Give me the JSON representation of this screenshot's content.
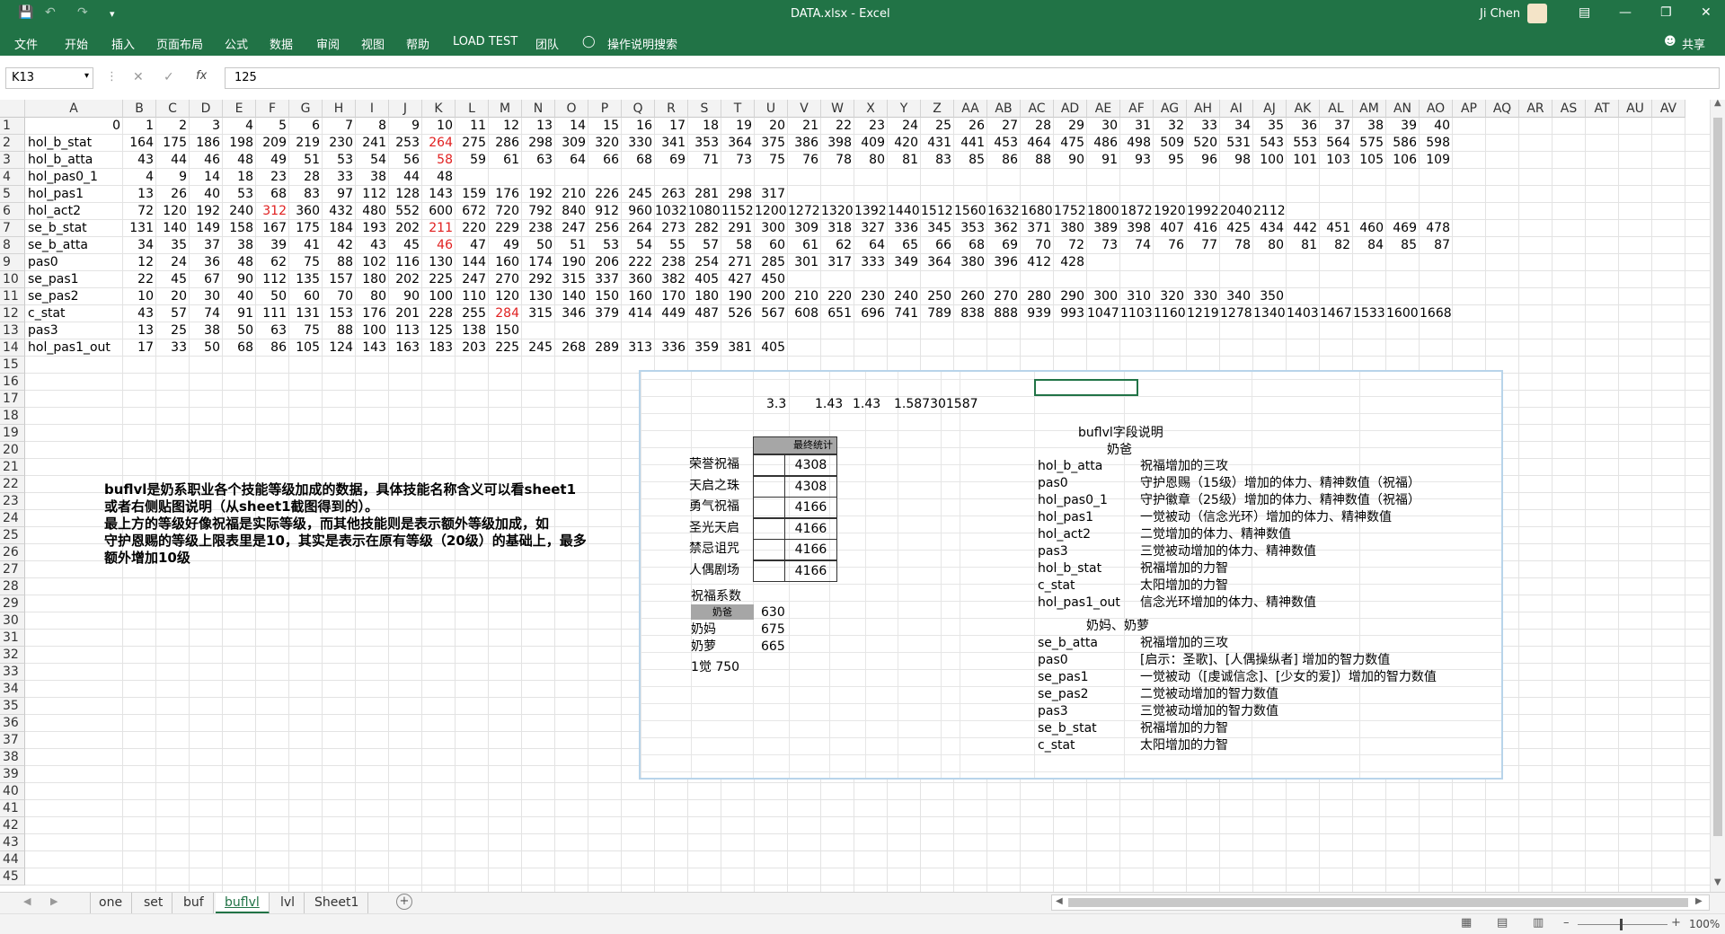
{
  "titlebar": {
    "title": "DATA.xlsx  -  Excel",
    "user": "Ji Chen",
    "share": "共享"
  },
  "menu": [
    "文件",
    "开始",
    "插入",
    "页面布局",
    "公式",
    "数据",
    "审阅",
    "视图",
    "帮助",
    "LOAD TEST",
    "团队"
  ],
  "tell_me": "操作说明搜索",
  "formula_bar": {
    "name_box": "K13",
    "fx": "fx",
    "value": "125"
  },
  "columns": [
    "A",
    "B",
    "C",
    "D",
    "E",
    "F",
    "G",
    "H",
    "I",
    "J",
    "K",
    "L",
    "M",
    "N",
    "O",
    "P",
    "Q",
    "R",
    "S",
    "T",
    "U",
    "V",
    "W",
    "X",
    "Y",
    "Z",
    "AA",
    "AB",
    "AC",
    "AD",
    "AE",
    "AF",
    "AG",
    "AH",
    "AI",
    "AJ",
    "AK",
    "AL",
    "AM",
    "AN",
    "AO",
    "AP",
    "AQ",
    "AR",
    "AS",
    "AT",
    "AU",
    "AV"
  ],
  "row_count": 45,
  "row1_values": [
    "0",
    "1",
    "2",
    "3",
    "4",
    "5",
    "6",
    "7",
    "8",
    "9",
    "10",
    "11",
    "12",
    "13",
    "14",
    "15",
    "16",
    "17",
    "18",
    "19",
    "20",
    "21",
    "22",
    "23",
    "24",
    "25",
    "26",
    "27",
    "28",
    "29",
    "30",
    "31",
    "32",
    "33",
    "34",
    "35",
    "36",
    "37",
    "38",
    "39",
    "40"
  ],
  "data_rows": [
    {
      "label": "hol_b_stat",
      "values": [
        "164",
        "175",
        "186",
        "198",
        "209",
        "219",
        "230",
        "241",
        "253",
        "264",
        "275",
        "286",
        "298",
        "309",
        "320",
        "330",
        "341",
        "353",
        "364",
        "375",
        "386",
        "398",
        "409",
        "420",
        "431",
        "441",
        "453",
        "464",
        "475",
        "486",
        "498",
        "509",
        "520",
        "531",
        "543",
        "553",
        "564",
        "575",
        "586",
        "598"
      ],
      "red": [
        9
      ]
    },
    {
      "label": "hol_b_atta",
      "values": [
        "43",
        "44",
        "46",
        "48",
        "49",
        "51",
        "53",
        "54",
        "56",
        "58",
        "59",
        "61",
        "63",
        "64",
        "66",
        "68",
        "69",
        "71",
        "73",
        "75",
        "76",
        "78",
        "80",
        "81",
        "83",
        "85",
        "86",
        "88",
        "90",
        "91",
        "93",
        "95",
        "96",
        "98",
        "100",
        "101",
        "103",
        "105",
        "106",
        "109"
      ],
      "red": [
        9
      ]
    },
    {
      "label": "hol_pas0_1",
      "values": [
        "4",
        "9",
        "14",
        "18",
        "23",
        "28",
        "33",
        "38",
        "44",
        "48"
      ],
      "red": []
    },
    {
      "label": "hol_pas1",
      "values": [
        "13",
        "26",
        "40",
        "53",
        "68",
        "83",
        "97",
        "112",
        "128",
        "143",
        "159",
        "176",
        "192",
        "210",
        "226",
        "245",
        "263",
        "281",
        "298",
        "317"
      ],
      "red": []
    },
    {
      "label": "hol_act2",
      "values": [
        "72",
        "120",
        "192",
        "240",
        "312",
        "360",
        "432",
        "480",
        "552",
        "600",
        "672",
        "720",
        "792",
        "840",
        "912",
        "960",
        "1032",
        "1080",
        "1152",
        "1200",
        "1272",
        "1320",
        "1392",
        "1440",
        "1512",
        "1560",
        "1632",
        "1680",
        "1752",
        "1800",
        "1872",
        "1920",
        "1992",
        "2040",
        "2112"
      ],
      "red": [
        4
      ]
    },
    {
      "label": "se_b_stat",
      "values": [
        "131",
        "140",
        "149",
        "158",
        "167",
        "175",
        "184",
        "193",
        "202",
        "211",
        "220",
        "229",
        "238",
        "247",
        "256",
        "264",
        "273",
        "282",
        "291",
        "300",
        "309",
        "318",
        "327",
        "336",
        "345",
        "353",
        "362",
        "371",
        "380",
        "389",
        "398",
        "407",
        "416",
        "425",
        "434",
        "442",
        "451",
        "460",
        "469",
        "478"
      ],
      "red": [
        9
      ]
    },
    {
      "label": "se_b_atta",
      "values": [
        "34",
        "35",
        "37",
        "38",
        "39",
        "41",
        "42",
        "43",
        "45",
        "46",
        "47",
        "49",
        "50",
        "51",
        "53",
        "54",
        "55",
        "57",
        "58",
        "60",
        "61",
        "62",
        "64",
        "65",
        "66",
        "68",
        "69",
        "70",
        "72",
        "73",
        "74",
        "76",
        "77",
        "78",
        "80",
        "81",
        "82",
        "84",
        "85",
        "87"
      ],
      "red": [
        9
      ]
    },
    {
      "label": "pas0",
      "values": [
        "12",
        "24",
        "36",
        "48",
        "62",
        "75",
        "88",
        "102",
        "116",
        "130",
        "144",
        "160",
        "174",
        "190",
        "206",
        "222",
        "238",
        "254",
        "271",
        "285",
        "301",
        "317",
        "333",
        "349",
        "364",
        "380",
        "396",
        "412",
        "428"
      ],
      "red": []
    },
    {
      "label": "se_pas1",
      "values": [
        "22",
        "45",
        "67",
        "90",
        "112",
        "135",
        "157",
        "180",
        "202",
        "225",
        "247",
        "270",
        "292",
        "315",
        "337",
        "360",
        "382",
        "405",
        "427",
        "450"
      ],
      "red": []
    },
    {
      "label": "se_pas2",
      "values": [
        "10",
        "20",
        "30",
        "40",
        "50",
        "60",
        "70",
        "80",
        "90",
        "100",
        "110",
        "120",
        "130",
        "140",
        "150",
        "160",
        "170",
        "180",
        "190",
        "200",
        "210",
        "220",
        "230",
        "240",
        "250",
        "260",
        "270",
        "280",
        "290",
        "300",
        "310",
        "320",
        "330",
        "340",
        "350"
      ],
      "red": []
    },
    {
      "label": "c_stat",
      "values": [
        "43",
        "57",
        "74",
        "91",
        "111",
        "131",
        "153",
        "176",
        "201",
        "228",
        "255",
        "284",
        "315",
        "346",
        "379",
        "414",
        "449",
        "487",
        "526",
        "567",
        "608",
        "651",
        "696",
        "741",
        "789",
        "838",
        "888",
        "939",
        "993",
        "1047",
        "1103",
        "1160",
        "1219",
        "1278",
        "1340",
        "1403",
        "1467",
        "1533",
        "1600",
        "1668"
      ],
      "red": [
        11
      ]
    },
    {
      "label": "pas3",
      "values": [
        "13",
        "25",
        "38",
        "50",
        "63",
        "75",
        "88",
        "100",
        "113",
        "125",
        "138",
        "150"
      ],
      "red": []
    },
    {
      "label": "hol_pas1_out",
      "values": [
        "17",
        "33",
        "50",
        "68",
        "86",
        "105",
        "124",
        "143",
        "163",
        "183",
        "203",
        "225",
        "245",
        "268",
        "289",
        "313",
        "336",
        "359",
        "381",
        "405"
      ],
      "red": []
    }
  ],
  "note_text": [
    "buflvl是奶系职业各个技能等级加成的数据，具体技能名称含义可以看sheet1",
    "或者右侧贴图说明（从sheet1截图得到的）。",
    "最上方的等级好像祝福是实际等级，而其他技能则是表示额外等级加成，如",
    "守护恩赐的等级上限表里是10，其实是表示在原有等级（20级）的基础上，最多",
    "额外增加10级"
  ],
  "pic_values": [
    "3.3",
    "1.43",
    "1.43",
    "1.587301587"
  ],
  "pic_stats_header": "最终统计",
  "pic_stats": [
    {
      "name": "荣誉祝福",
      "value": "4308"
    },
    {
      "name": "天启之珠",
      "value": "4308"
    },
    {
      "name": "勇气祝福",
      "value": "4166"
    },
    {
      "name": "圣光天启",
      "value": "4166"
    },
    {
      "name": "禁忌诅咒",
      "value": "4166"
    },
    {
      "name": "人偶剧场",
      "value": "4166"
    }
  ],
  "pic_coef_title": "祝福系数",
  "pic_coef": [
    {
      "name": "奶爸",
      "value": "630"
    },
    {
      "name": "奶妈",
      "value": "675"
    },
    {
      "name": "奶萝",
      "value": "665"
    }
  ],
  "pic_awaken": "1觉 750",
  "pic_desc_title": "buflvl字段说明",
  "pic_group1": "奶爸",
  "pic_desc1": [
    {
      "k": "hol_b_atta",
      "v": "祝福增加的三攻"
    },
    {
      "k": "pas0",
      "v": "守护恩赐（15级）增加的体力、精神数值（祝福）"
    },
    {
      "k": "hol_pas0_1",
      "v": "守护徽章（25级）增加的体力、精神数值（祝福）"
    },
    {
      "k": "hol_pas1",
      "v": "一觉被动（信念光环）增加的体力、精神数值"
    },
    {
      "k": "hol_act2",
      "v": "二觉增加的体力、精神数值"
    },
    {
      "k": "pas3",
      "v": "三觉被动增加的体力、精神数值"
    },
    {
      "k": "hol_b_stat",
      "v": "祝福增加的力智"
    },
    {
      "k": "c_stat",
      "v": "太阳增加的力智"
    },
    {
      "k": "hol_pas1_out",
      "v": "信念光环增加的体力、精神数值"
    }
  ],
  "pic_group2": "奶妈、奶萝",
  "pic_desc2": [
    {
      "k": "se_b_atta",
      "v": "祝福增加的三攻"
    },
    {
      "k": "pas0",
      "v": "[启示：圣歌]、[人偶操纵者] 增加的智力数值"
    },
    {
      "k": "se_pas1",
      "v": "一觉被动（[虔诚信念]、[少女的爱]）增加的智力数值"
    },
    {
      "k": "se_pas2",
      "v": "二觉被动增加的智力数值"
    },
    {
      "k": "pas3",
      "v": "三觉被动增加的智力数值"
    },
    {
      "k": "se_b_stat",
      "v": "祝福增加的力智"
    },
    {
      "k": "c_stat",
      "v": "太阳增加的力智"
    }
  ],
  "sheet_tabs": [
    "one",
    "set",
    "buf",
    "buflvl",
    "lvl",
    "Sheet1"
  ],
  "active_tab": "buflvl",
  "zoom": "100%"
}
